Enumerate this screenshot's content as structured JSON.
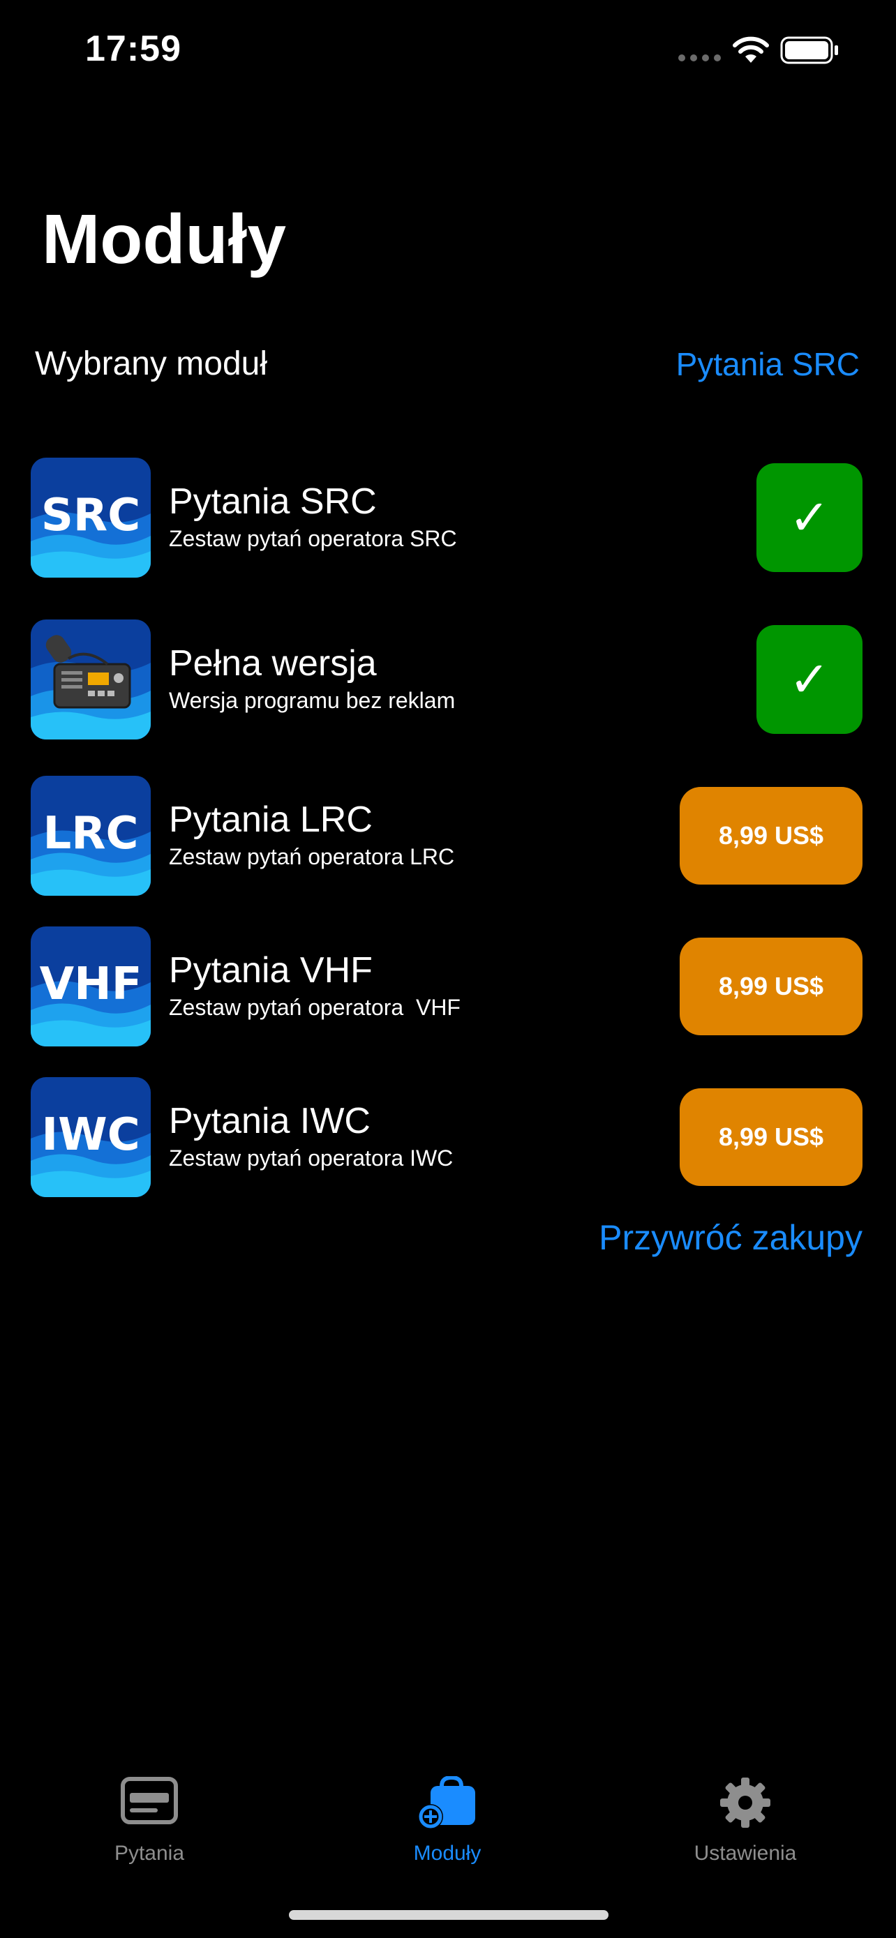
{
  "status_bar": {
    "time": "17:59"
  },
  "header": {
    "title": "Moduły"
  },
  "selected_module": {
    "label": "Wybrany moduł",
    "value": "Pytania SRC"
  },
  "modules": [
    {
      "icon_text": "SRC",
      "icon_name": "src-module-icon",
      "name": "Pytania SRC",
      "description": "Zestaw pytań operatora SRC",
      "state": "owned",
      "action": "✓"
    },
    {
      "icon_text": "",
      "icon_name": "radio-module-icon",
      "name": "Pełna wersja",
      "description": "Wersja programu bez reklam",
      "state": "owned",
      "action": "✓"
    },
    {
      "icon_text": "LRC",
      "icon_name": "lrc-module-icon",
      "name": "Pytania LRC",
      "description": "Zestaw pytań operatora LRC",
      "state": "purchase",
      "action": "8,99 US$"
    },
    {
      "icon_text": "VHF",
      "icon_name": "vhf-module-icon",
      "name": "Pytania VHF",
      "description": "Zestaw pytań operatora  VHF",
      "state": "purchase",
      "action": "8,99 US$"
    },
    {
      "icon_text": "IWC",
      "icon_name": "iwc-module-icon",
      "name": "Pytania IWC",
      "description": "Zestaw pytań operatora IWC",
      "state": "purchase",
      "action": "8,99 US$"
    }
  ],
  "restore_purchases": "Przywróć zakupy",
  "tab_bar": {
    "tabs": [
      {
        "label": "Pytania",
        "icon": "card-icon",
        "active": false
      },
      {
        "label": "Moduły",
        "icon": "bag-add-icon",
        "active": true
      },
      {
        "label": "Ustawienia",
        "icon": "gear-icon",
        "active": false
      }
    ]
  },
  "colors": {
    "background": "#000000",
    "accent_blue": "#1a8cff",
    "owned_green": "#009600",
    "price_orange": "#e08400",
    "inactive_tab": "#8e8e8e"
  }
}
